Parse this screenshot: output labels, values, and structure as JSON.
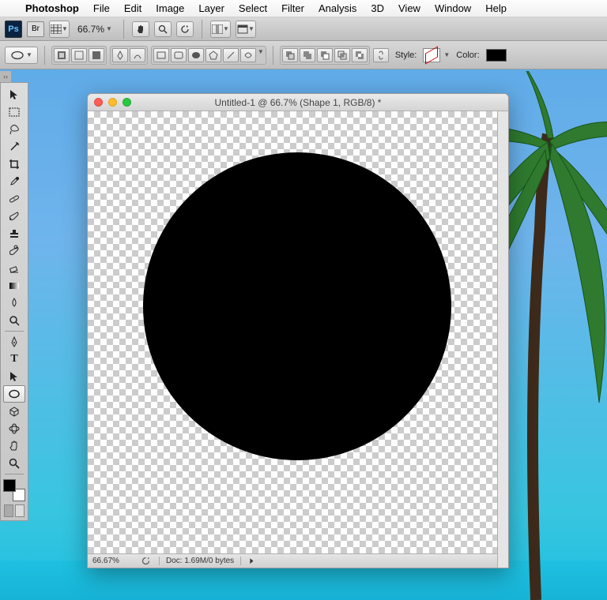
{
  "menubar": {
    "app": "Photoshop",
    "items": [
      "File",
      "Edit",
      "Image",
      "Layer",
      "Select",
      "Filter",
      "Analysis",
      "3D",
      "View",
      "Window",
      "Help"
    ]
  },
  "topbar": {
    "ps_abbrev": "Ps",
    "br_abbrev": "Br",
    "zoom_label": "66.7%"
  },
  "optbar": {
    "style_label": "Style:",
    "color_label": "Color:",
    "color_value": "#000000"
  },
  "tools": [
    {
      "name": "move-tool",
      "glyph": "cursor"
    },
    {
      "name": "marquee-tool",
      "glyph": "marquee"
    },
    {
      "name": "lasso-tool",
      "glyph": "lasso"
    },
    {
      "name": "wand-tool",
      "glyph": "wand"
    },
    {
      "name": "crop-tool",
      "glyph": "crop"
    },
    {
      "name": "eyedropper-tool",
      "glyph": "eyedrop"
    },
    {
      "name": "healing-tool",
      "glyph": "bandaid"
    },
    {
      "name": "brush-tool",
      "glyph": "brush"
    },
    {
      "name": "stamp-tool",
      "glyph": "stamp"
    },
    {
      "name": "history-brush-tool",
      "glyph": "histbrush"
    },
    {
      "name": "eraser-tool",
      "glyph": "eraser"
    },
    {
      "name": "gradient-tool",
      "glyph": "gradient"
    },
    {
      "name": "blur-tool",
      "glyph": "drop"
    },
    {
      "name": "dodge-tool",
      "glyph": "dodge"
    },
    {
      "name": "pen-tool",
      "glyph": "pen"
    },
    {
      "name": "type-tool",
      "glyph": "T"
    },
    {
      "name": "path-select-tool",
      "glyph": "pathsel"
    },
    {
      "name": "ellipse-tool",
      "glyph": "ellipse",
      "selected": true
    },
    {
      "name": "3d-tool",
      "glyph": "3d"
    },
    {
      "name": "3d-camera-tool",
      "glyph": "3dcam"
    },
    {
      "name": "hand-tool",
      "glyph": "hand"
    },
    {
      "name": "zoom-tool",
      "glyph": "zoom"
    }
  ],
  "doc": {
    "title": "Untitled-1 @ 66.7% (Shape 1, RGB/8) *",
    "status_zoom": "66.67%",
    "status_doc": "Doc: 1.69M/0 bytes"
  }
}
